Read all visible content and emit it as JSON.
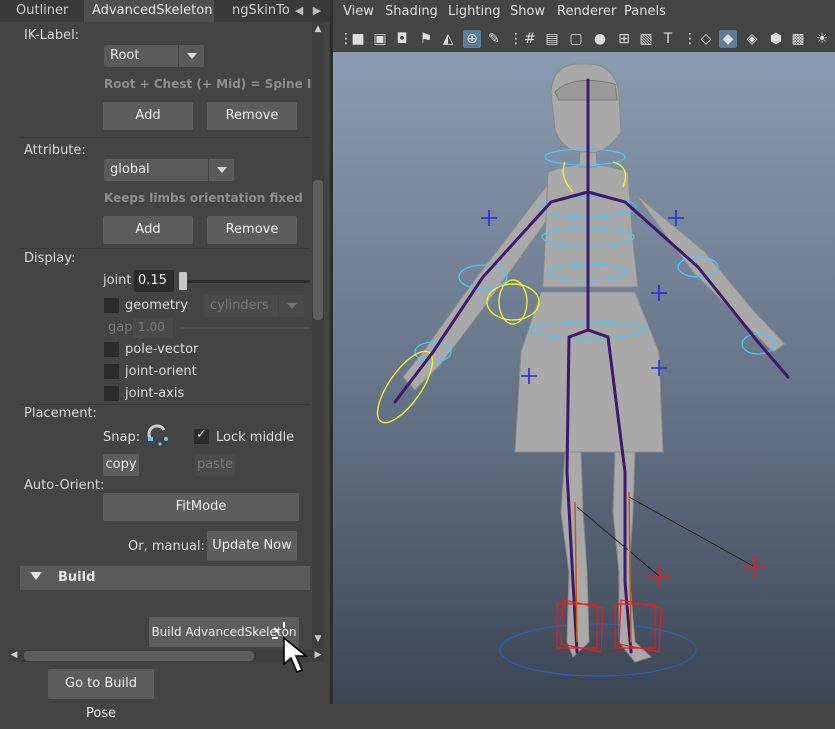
{
  "tabs": [
    {
      "label": "Outliner"
    },
    {
      "label": "AdvancedSkeleton"
    },
    {
      "label": "ngSkinToc"
    }
  ],
  "ik_label": {
    "section": "IK-Label:",
    "value": "Root",
    "hint": "Root + Chest (+ Mid) = Spine IK",
    "add": "Add",
    "remove": "Remove"
  },
  "attribute": {
    "section": "Attribute:",
    "value": "global",
    "hint": "Keeps limbs orientation fixed",
    "add": "Add",
    "remove": "Remove"
  },
  "display": {
    "section": "Display:",
    "joint_label": "joint",
    "joint_value": "0.15",
    "slider_fraction": 0.0,
    "geometry_label": "geometry",
    "geometry_mode": "cylinders",
    "gap_label": "gap",
    "gap_value": "1.00",
    "pole_vector": "pole-vector",
    "joint_orient": "joint-orient",
    "joint_axis": "joint-axis"
  },
  "placement": {
    "section": "Placement:",
    "snap": "Snap:",
    "lock_middle": "Lock middle",
    "lock_middle_checked": true,
    "copy": "copy",
    "paste": "paste"
  },
  "auto_orient": {
    "section": "Auto-Orient:",
    "fitmode": "FitMode",
    "or_manual": "Or, manual:",
    "update_now": "Update Now"
  },
  "build": {
    "section": "Build",
    "build_button": "Build AdvancedSkeleton"
  },
  "footer": {
    "go_to_build_pose": "Go to Build Pose"
  },
  "viewport_menu": [
    {
      "label": "View"
    },
    {
      "label": "Shading"
    },
    {
      "label": "Lighting"
    },
    {
      "label": "Show"
    },
    {
      "label": "Renderer"
    },
    {
      "label": "Panels"
    }
  ],
  "colors": {
    "panel_bg": "#444444",
    "button_bg": "#5d5d5d",
    "viewport_top": "#8b9bb0",
    "viewport_bottom": "#3c4553",
    "joint": "#3d1a6b",
    "control_cyan": "#46c8ff",
    "control_yellow": "#f0ef30",
    "control_blue": "#2a2ad8",
    "ik_red": "#e02020"
  }
}
